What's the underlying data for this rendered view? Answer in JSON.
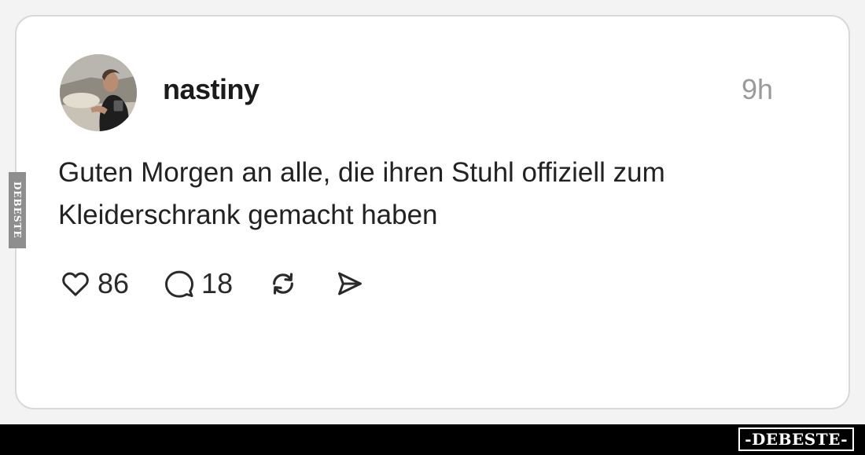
{
  "post": {
    "username": "nastiny",
    "time": "9h",
    "text": "Guten Morgen an alle, die ihren Stuhl offiziell zum Kleiderschrank gemacht haben",
    "avatar_icon": "profile-photo",
    "actions": {
      "like": {
        "icon": "heart-icon",
        "count": "86"
      },
      "comment": {
        "icon": "comment-bubble-icon",
        "count": "18"
      },
      "repost": {
        "icon": "repost-icon"
      },
      "share": {
        "icon": "send-icon"
      }
    }
  },
  "watermark": {
    "side": "DEBESTE",
    "bottom": "-DEBESTE-"
  },
  "colors": {
    "background": "#f3f3f3",
    "card": "#ffffff",
    "card_border": "#d9d9d9",
    "text": "#222222",
    "muted": "#9a9a9a",
    "bar": "#000000"
  }
}
